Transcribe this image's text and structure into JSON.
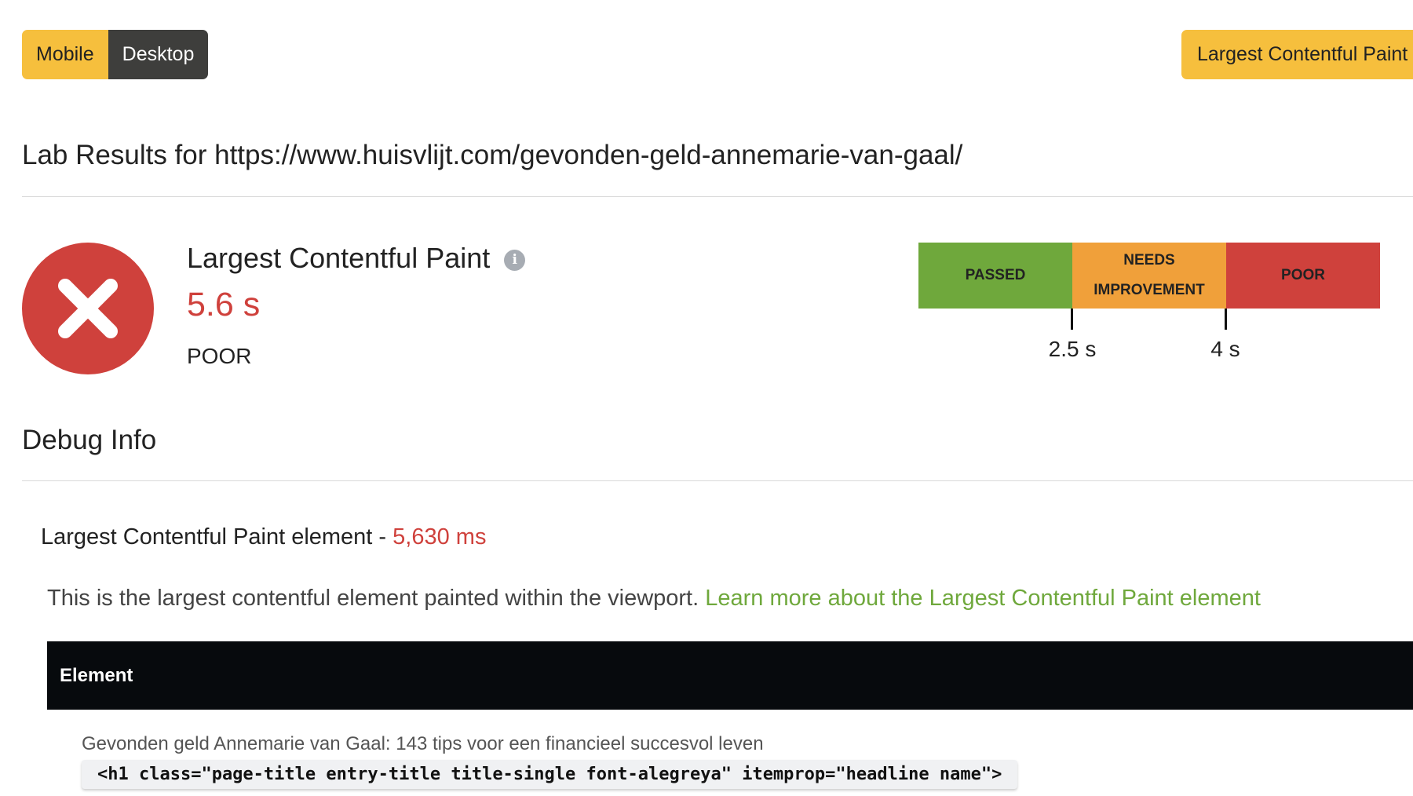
{
  "toggle": {
    "mobile_label": "Mobile",
    "desktop_label": "Desktop"
  },
  "metric_selector": {
    "label": "Largest Contentful Paint"
  },
  "lab": {
    "title": "Lab Results for https://www.huisvlijt.com/gevonden-geld-annemarie-van-gaal/"
  },
  "metric": {
    "name": "Largest Contentful Paint",
    "info_icon": "info-icon",
    "status_icon": "close-icon",
    "value": "5.6 s",
    "rating": "POOR"
  },
  "thresholds": {
    "segments": [
      {
        "label": "PASSED",
        "color": "#6fa83c"
      },
      {
        "label": "NEEDS IMPROVEMENT",
        "color": "#f0a03a"
      },
      {
        "label": "POOR",
        "color": "#cf413c"
      }
    ],
    "ticks": [
      "2.5 s",
      "4 s"
    ]
  },
  "debug": {
    "title": "Debug Info",
    "lcp_element_label": "Largest Contentful Paint element -",
    "lcp_element_ms": "5,630 ms",
    "description": "This is the largest contentful element painted within the viewport.",
    "learn_more": "Learn more about the Largest Contentful Paint element",
    "table": {
      "header": "Element",
      "rows": [
        {
          "text": "Gevonden geld Annemarie van Gaal: 143 tips voor een financieel succesvol leven",
          "code": "<h1 class=\"page-title entry-title title-single font-alegreya\" itemprop=\"headline name\">"
        }
      ]
    }
  },
  "colors": {
    "accent": "#f6bf3d",
    "poor": "#cf413c",
    "pass": "#6fa83c",
    "needs_improvement": "#f0a03a"
  }
}
